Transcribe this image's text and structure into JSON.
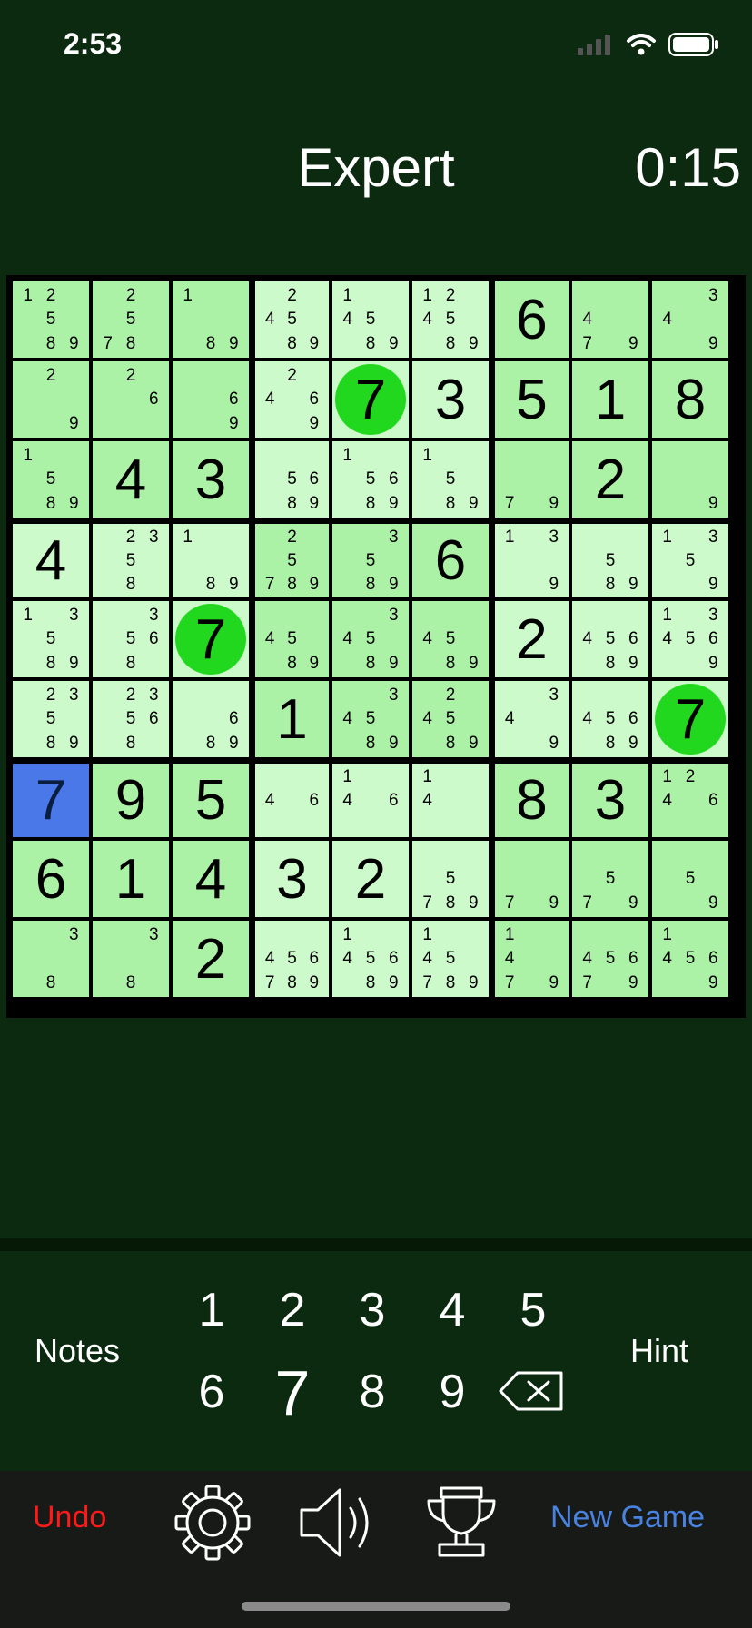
{
  "status_bar": {
    "time": "2:53"
  },
  "header": {
    "difficulty": "Expert",
    "timer": "0:15"
  },
  "board": {
    "selected": [
      6,
      0
    ],
    "circled": [
      [
        1,
        4
      ],
      [
        4,
        2
      ],
      [
        5,
        8
      ]
    ],
    "rows": [
      [
        {
          "n": [
            1,
            2,
            5,
            8,
            9
          ]
        },
        {
          "n": [
            2,
            5,
            7,
            8
          ]
        },
        {
          "n": [
            1,
            8,
            9
          ]
        },
        {
          "n": [
            2,
            4,
            5,
            8,
            9
          ]
        },
        {
          "n": [
            1,
            4,
            5,
            8,
            9
          ]
        },
        {
          "n": [
            1,
            2,
            4,
            5,
            8,
            9
          ]
        },
        {
          "v": 6
        },
        {
          "n": [
            4,
            7,
            9
          ]
        },
        {
          "n": [
            3,
            4,
            9
          ]
        }
      ],
      [
        {
          "n": [
            2,
            9
          ]
        },
        {
          "n": [
            2,
            6
          ]
        },
        {
          "n": [
            6,
            9
          ]
        },
        {
          "n": [
            2,
            4,
            6,
            9
          ]
        },
        {
          "v": 7
        },
        {
          "v": 3
        },
        {
          "v": 5
        },
        {
          "v": 1
        },
        {
          "v": 8
        }
      ],
      [
        {
          "n": [
            1,
            5,
            8,
            9
          ]
        },
        {
          "v": 4
        },
        {
          "v": 3
        },
        {
          "n": [
            5,
            6,
            8,
            9
          ]
        },
        {
          "n": [
            1,
            5,
            6,
            8,
            9
          ]
        },
        {
          "n": [
            1,
            5,
            8,
            9
          ]
        },
        {
          "n": [
            7,
            9
          ]
        },
        {
          "v": 2
        },
        {
          "n": [
            9
          ]
        }
      ],
      [
        {
          "v": 4
        },
        {
          "n": [
            2,
            3,
            5,
            8
          ]
        },
        {
          "n": [
            1,
            8,
            9
          ]
        },
        {
          "n": [
            2,
            5,
            7,
            8,
            9
          ]
        },
        {
          "n": [
            3,
            5,
            8,
            9
          ]
        },
        {
          "v": 6
        },
        {
          "n": [
            1,
            3,
            9
          ]
        },
        {
          "n": [
            5,
            8,
            9
          ]
        },
        {
          "n": [
            1,
            3,
            5,
            9
          ]
        }
      ],
      [
        {
          "n": [
            1,
            3,
            5,
            8,
            9
          ]
        },
        {
          "n": [
            3,
            5,
            6,
            8
          ]
        },
        {
          "v": 7
        },
        {
          "n": [
            4,
            5,
            8,
            9
          ]
        },
        {
          "n": [
            3,
            4,
            5,
            8,
            9
          ]
        },
        {
          "n": [
            4,
            5,
            8,
            9
          ]
        },
        {
          "v": 2
        },
        {
          "n": [
            4,
            5,
            6,
            8,
            9
          ]
        },
        {
          "n": [
            1,
            3,
            4,
            5,
            6,
            9
          ]
        }
      ],
      [
        {
          "n": [
            2,
            3,
            5,
            8,
            9
          ]
        },
        {
          "n": [
            2,
            3,
            5,
            6,
            8
          ]
        },
        {
          "n": [
            6,
            8,
            9
          ]
        },
        {
          "v": 1
        },
        {
          "n": [
            3,
            4,
            5,
            8,
            9
          ]
        },
        {
          "n": [
            2,
            4,
            5,
            8,
            9
          ]
        },
        {
          "n": [
            3,
            4,
            9
          ]
        },
        {
          "n": [
            4,
            5,
            6,
            8,
            9
          ]
        },
        {
          "v": 7
        }
      ],
      [
        {
          "v": 7
        },
        {
          "v": 9
        },
        {
          "v": 5
        },
        {
          "n": [
            4,
            6
          ]
        },
        {
          "n": [
            1,
            4,
            6
          ]
        },
        {
          "n": [
            1,
            4
          ]
        },
        {
          "v": 8
        },
        {
          "v": 3
        },
        {
          "n": [
            1,
            2,
            4,
            6
          ]
        }
      ],
      [
        {
          "v": 6
        },
        {
          "v": 1
        },
        {
          "v": 4
        },
        {
          "v": 3
        },
        {
          "v": 2
        },
        {
          "n": [
            5,
            7,
            8,
            9
          ]
        },
        {
          "n": [
            7,
            9
          ]
        },
        {
          "n": [
            5,
            7,
            9
          ]
        },
        {
          "n": [
            5,
            9
          ]
        }
      ],
      [
        {
          "n": [
            3,
            8
          ]
        },
        {
          "n": [
            3,
            8
          ]
        },
        {
          "v": 2
        },
        {
          "n": [
            4,
            5,
            6,
            7,
            8,
            9
          ]
        },
        {
          "n": [
            1,
            4,
            5,
            6,
            8,
            9
          ]
        },
        {
          "n": [
            1,
            4,
            5,
            7,
            8,
            9
          ]
        },
        {
          "n": [
            1,
            4,
            7,
            9
          ]
        },
        {
          "n": [
            4,
            5,
            6,
            7,
            9
          ]
        },
        {
          "n": [
            1,
            4,
            5,
            6,
            9
          ]
        }
      ]
    ]
  },
  "number_pad": {
    "notes_label": "Notes",
    "hint_label": "Hint",
    "digits": [
      "1",
      "2",
      "3",
      "4",
      "5",
      "6",
      "7",
      "8",
      "9"
    ],
    "active_digit": "7",
    "backspace_icon": "backspace-icon"
  },
  "toolbar": {
    "undo_label": "Undo",
    "new_game_label": "New Game",
    "icons": [
      "gear-icon",
      "speaker-icon",
      "trophy-icon"
    ]
  },
  "colors": {
    "background": "#0b2a0f",
    "cell_light": "#cdfacb",
    "cell_dark": "#acf2a6",
    "selected": "#4a78e8",
    "highlight_circle": "#22d81e",
    "undo": "#ff1a1a",
    "new_game": "#4a82e0"
  }
}
